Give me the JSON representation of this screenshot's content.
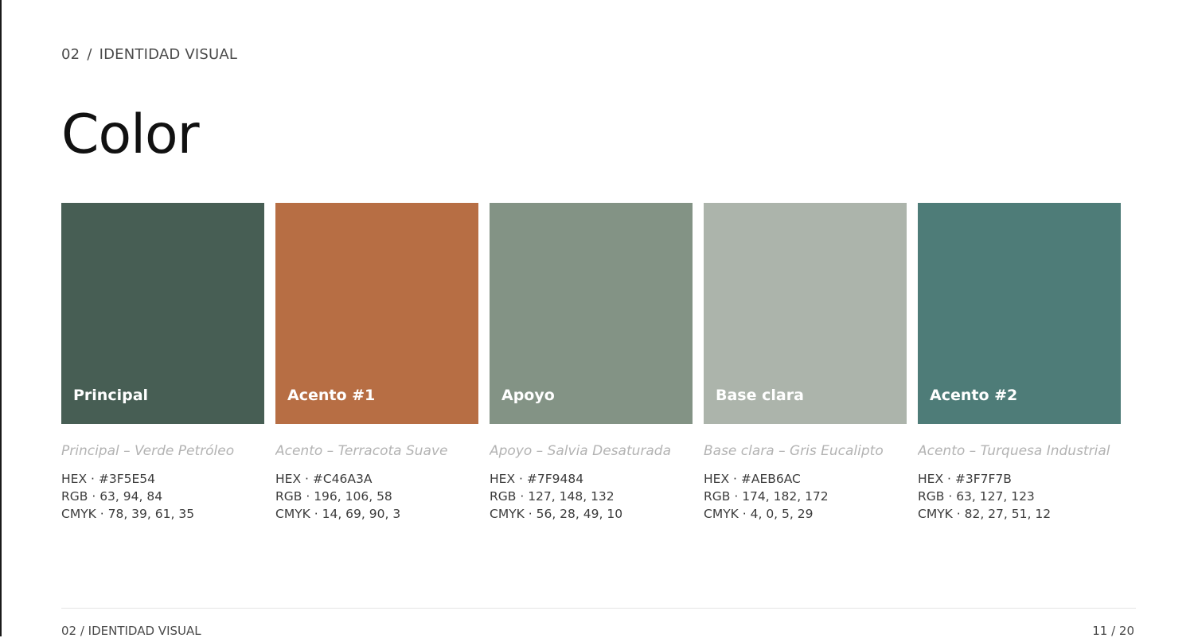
{
  "header": {
    "section_number": "02",
    "separator": "/",
    "section_title": "IDENTIDAD VISUAL"
  },
  "title": "Color",
  "palette": [
    {
      "label": "Principal",
      "caption": "Principal – Verde Petróleo",
      "hex": "HEX · #3F5E54",
      "rgb": "RGB · 63, 94, 84",
      "cmyk": "CMYK · 78, 39, 61, 35",
      "color": "#475E54"
    },
    {
      "label": "Acento #1",
      "caption": "Acento – Terracota Suave",
      "hex": "HEX · #C46A3A",
      "rgb": "RGB · 196, 106, 58",
      "cmyk": "CMYK · 14, 69, 90, 3",
      "color": "#B76E44"
    },
    {
      "label": "Apoyo",
      "caption": "Apoyo – Salvia Desaturada",
      "hex": "HEX · #7F9484",
      "rgb": "RGB · 127, 148, 132",
      "cmyk": "CMYK · 56, 28, 49, 10",
      "color": "#839385"
    },
    {
      "label": "Base clara",
      "caption": "Base clara – Gris Eucalipto",
      "hex": "HEX · #AEB6AC",
      "rgb": "RGB · 174, 182, 172",
      "cmyk": "CMYK · 4, 0, 5, 29",
      "color": "#ACB4AB"
    },
    {
      "label": "Acento #2",
      "caption": "Acento – Turquesa Industrial",
      "hex": "HEX · #3F7F7B",
      "rgb": "RGB · 63, 127, 123",
      "cmyk": "CMYK · 82, 27, 51, 12",
      "color": "#4E7C78"
    }
  ],
  "footer": {
    "left": "02 / IDENTIDAD VISUAL",
    "page": "11 / 20"
  }
}
